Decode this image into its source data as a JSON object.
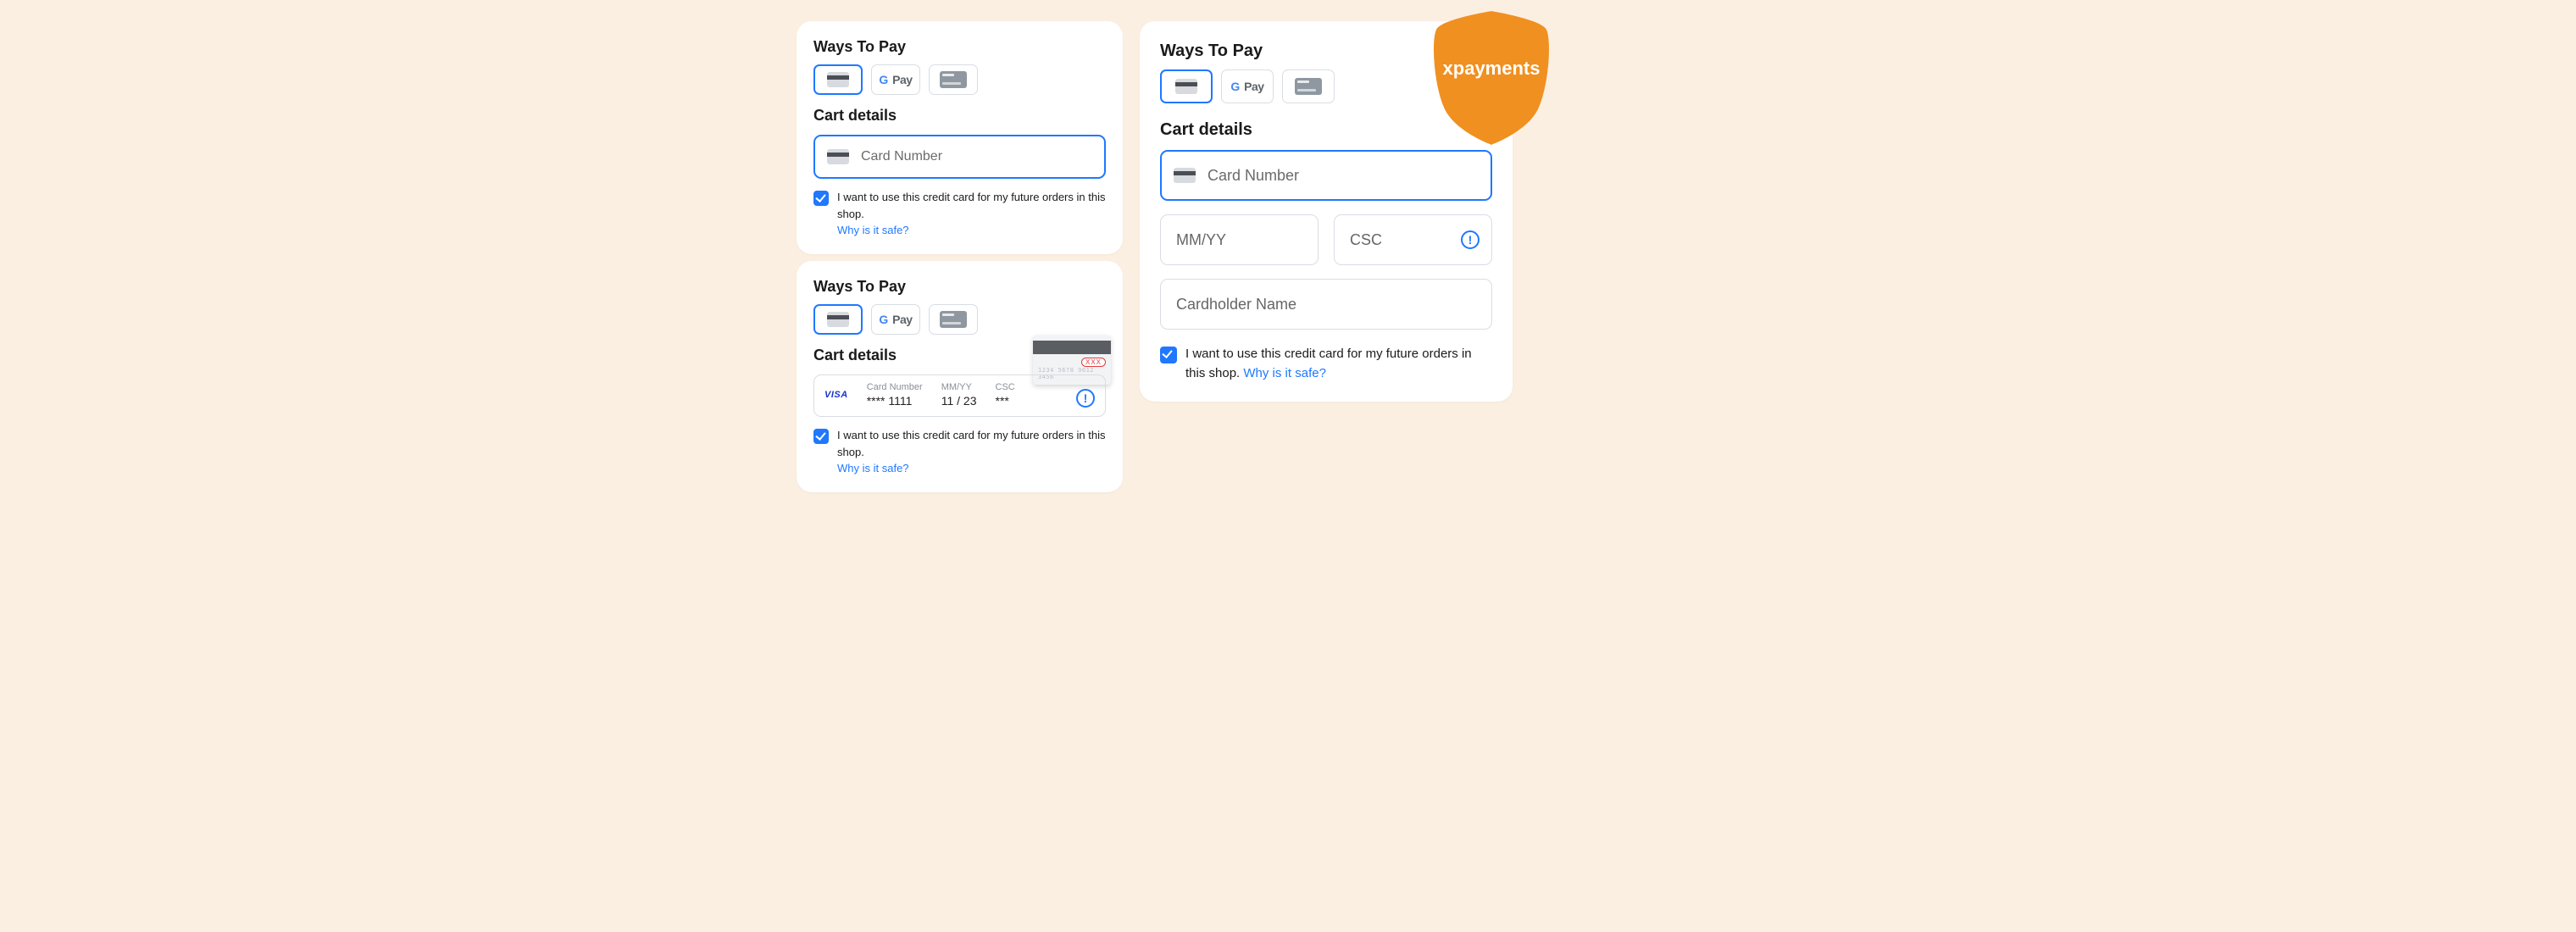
{
  "shield": {
    "brand": "xpayments"
  },
  "common": {
    "ways_heading": "Ways To Pay",
    "cart_heading": "Cart details",
    "gpay_label": "G Pay",
    "save_card_text": "I want to use this credit card for my future orders in this shop.",
    "why_safe": "Why is it safe?"
  },
  "panelA": {
    "card_number_placeholder": "Card Number"
  },
  "panelB": {
    "card_label": "Card Number",
    "card_value": "**** 1111",
    "exp_label": "MM/YY",
    "exp_value": "11 / 23",
    "csc_label": "CSC",
    "csc_value": "***",
    "tooltip_xxx": "XXX",
    "tooltip_digits": "1234 5678 9012 3456"
  },
  "panelC": {
    "card_number_placeholder": "Card Number",
    "exp_placeholder": "MM/YY",
    "csc_placeholder": "CSC",
    "name_placeholder": "Cardholder Name",
    "save_card_text": "I want to use this credit card for my future orders in this shop.",
    "why_safe": "Why is it safe?"
  }
}
